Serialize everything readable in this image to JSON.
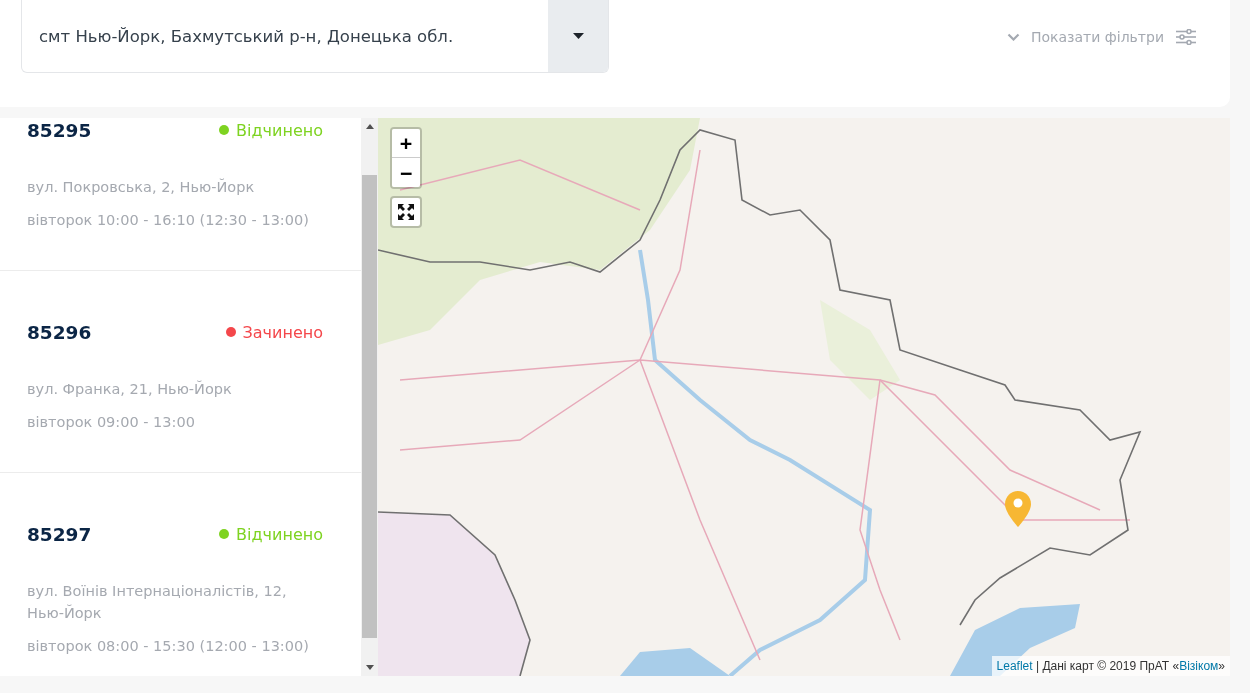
{
  "header": {
    "location_select": {
      "value": "смт Нью-Йорк, Бахмутський р-н, Донецька обл."
    },
    "filters_toggle": {
      "label": "Показати фільтри",
      "expanded": false
    }
  },
  "offices": [
    {
      "number": "85295",
      "status": "Відчинено",
      "open": true,
      "address": "вул. Покровська, 2, Нью-Йорк",
      "hours": "вівторок 10:00 - 16:10 (12:30 - 13:00)"
    },
    {
      "number": "85296",
      "status": "Зачинено",
      "open": false,
      "address": "вул. Франка, 21, Нью-Йорк",
      "hours": "вівторок 09:00 - 13:00"
    },
    {
      "number": "85297",
      "status": "Відчинено",
      "open": true,
      "address": "вул. Воїнів Інтернаціоналістів, 12, Нью-Йорк",
      "hours": "вівторок 08:00 - 15:30 (12:00 - 13:00)"
    }
  ],
  "map": {
    "zoom_in": "+",
    "zoom_out": "−",
    "attribution": [
      {
        "kind": "link",
        "text": "Leaflet"
      },
      {
        "kind": "text",
        "text": " | Дані карт © 2019 ПрАТ «"
      },
      {
        "kind": "link",
        "text": "Візіком"
      },
      {
        "kind": "text",
        "text": "»"
      }
    ]
  }
}
